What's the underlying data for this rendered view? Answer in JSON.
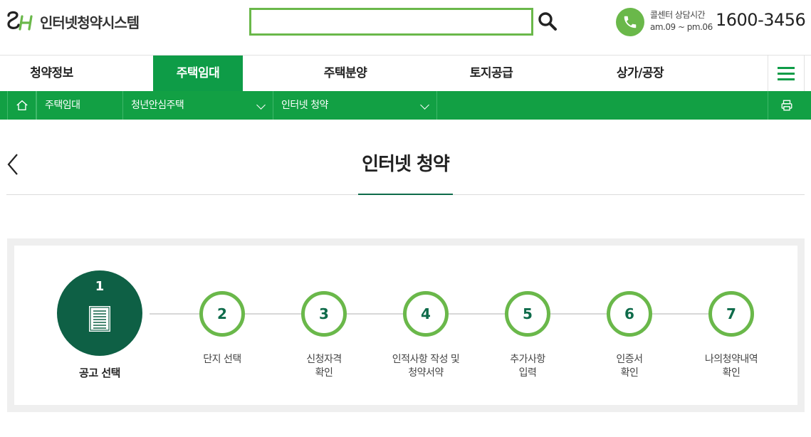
{
  "header": {
    "logo_mark": "SH",
    "logo_text": "인터넷청약시스템",
    "search": {
      "value": "",
      "placeholder": ""
    },
    "callcenter_label": "콜센터 상담시간",
    "callcenter_hours": "am.09 ~ pm.06",
    "phone_number": "1600-3456"
  },
  "nav": {
    "items": [
      {
        "label": "청약정보",
        "active": false
      },
      {
        "label": "주택임대",
        "active": true
      },
      {
        "label": "주택분양",
        "active": false
      },
      {
        "label": "토지공급",
        "active": false
      },
      {
        "label": "상가/공장",
        "active": false
      }
    ],
    "menu_icon": "hamburger-icon"
  },
  "location": {
    "home_icon": "home-icon",
    "crumbs": [
      {
        "label": "주택임대",
        "dropdown": false
      },
      {
        "label": "청년안심주택",
        "dropdown": true
      },
      {
        "label": "인터넷 청약",
        "dropdown": true
      }
    ],
    "print_icon": "printer-icon"
  },
  "page": {
    "title": "인터넷 청약",
    "back_icon": "chevron-left-icon"
  },
  "steps": {
    "current": 1,
    "items": [
      {
        "number": "1",
        "label_lines": [
          "공고 선택"
        ]
      },
      {
        "number": "2",
        "label_lines": [
          "단지 선택"
        ]
      },
      {
        "number": "3",
        "label_lines": [
          "신청자격",
          "확인"
        ]
      },
      {
        "number": "4",
        "label_lines": [
          "인적사항 작성 및",
          "청약서약"
        ]
      },
      {
        "number": "5",
        "label_lines": [
          "추가사항",
          "입력"
        ]
      },
      {
        "number": "6",
        "label_lines": [
          "인증서",
          "확인"
        ]
      },
      {
        "number": "7",
        "label_lines": [
          "나의청약내역",
          "확인"
        ]
      }
    ]
  },
  "colors": {
    "brand_green": "#0e9c47",
    "light_green": "#6ab84a",
    "dark_green": "#0e6045"
  }
}
